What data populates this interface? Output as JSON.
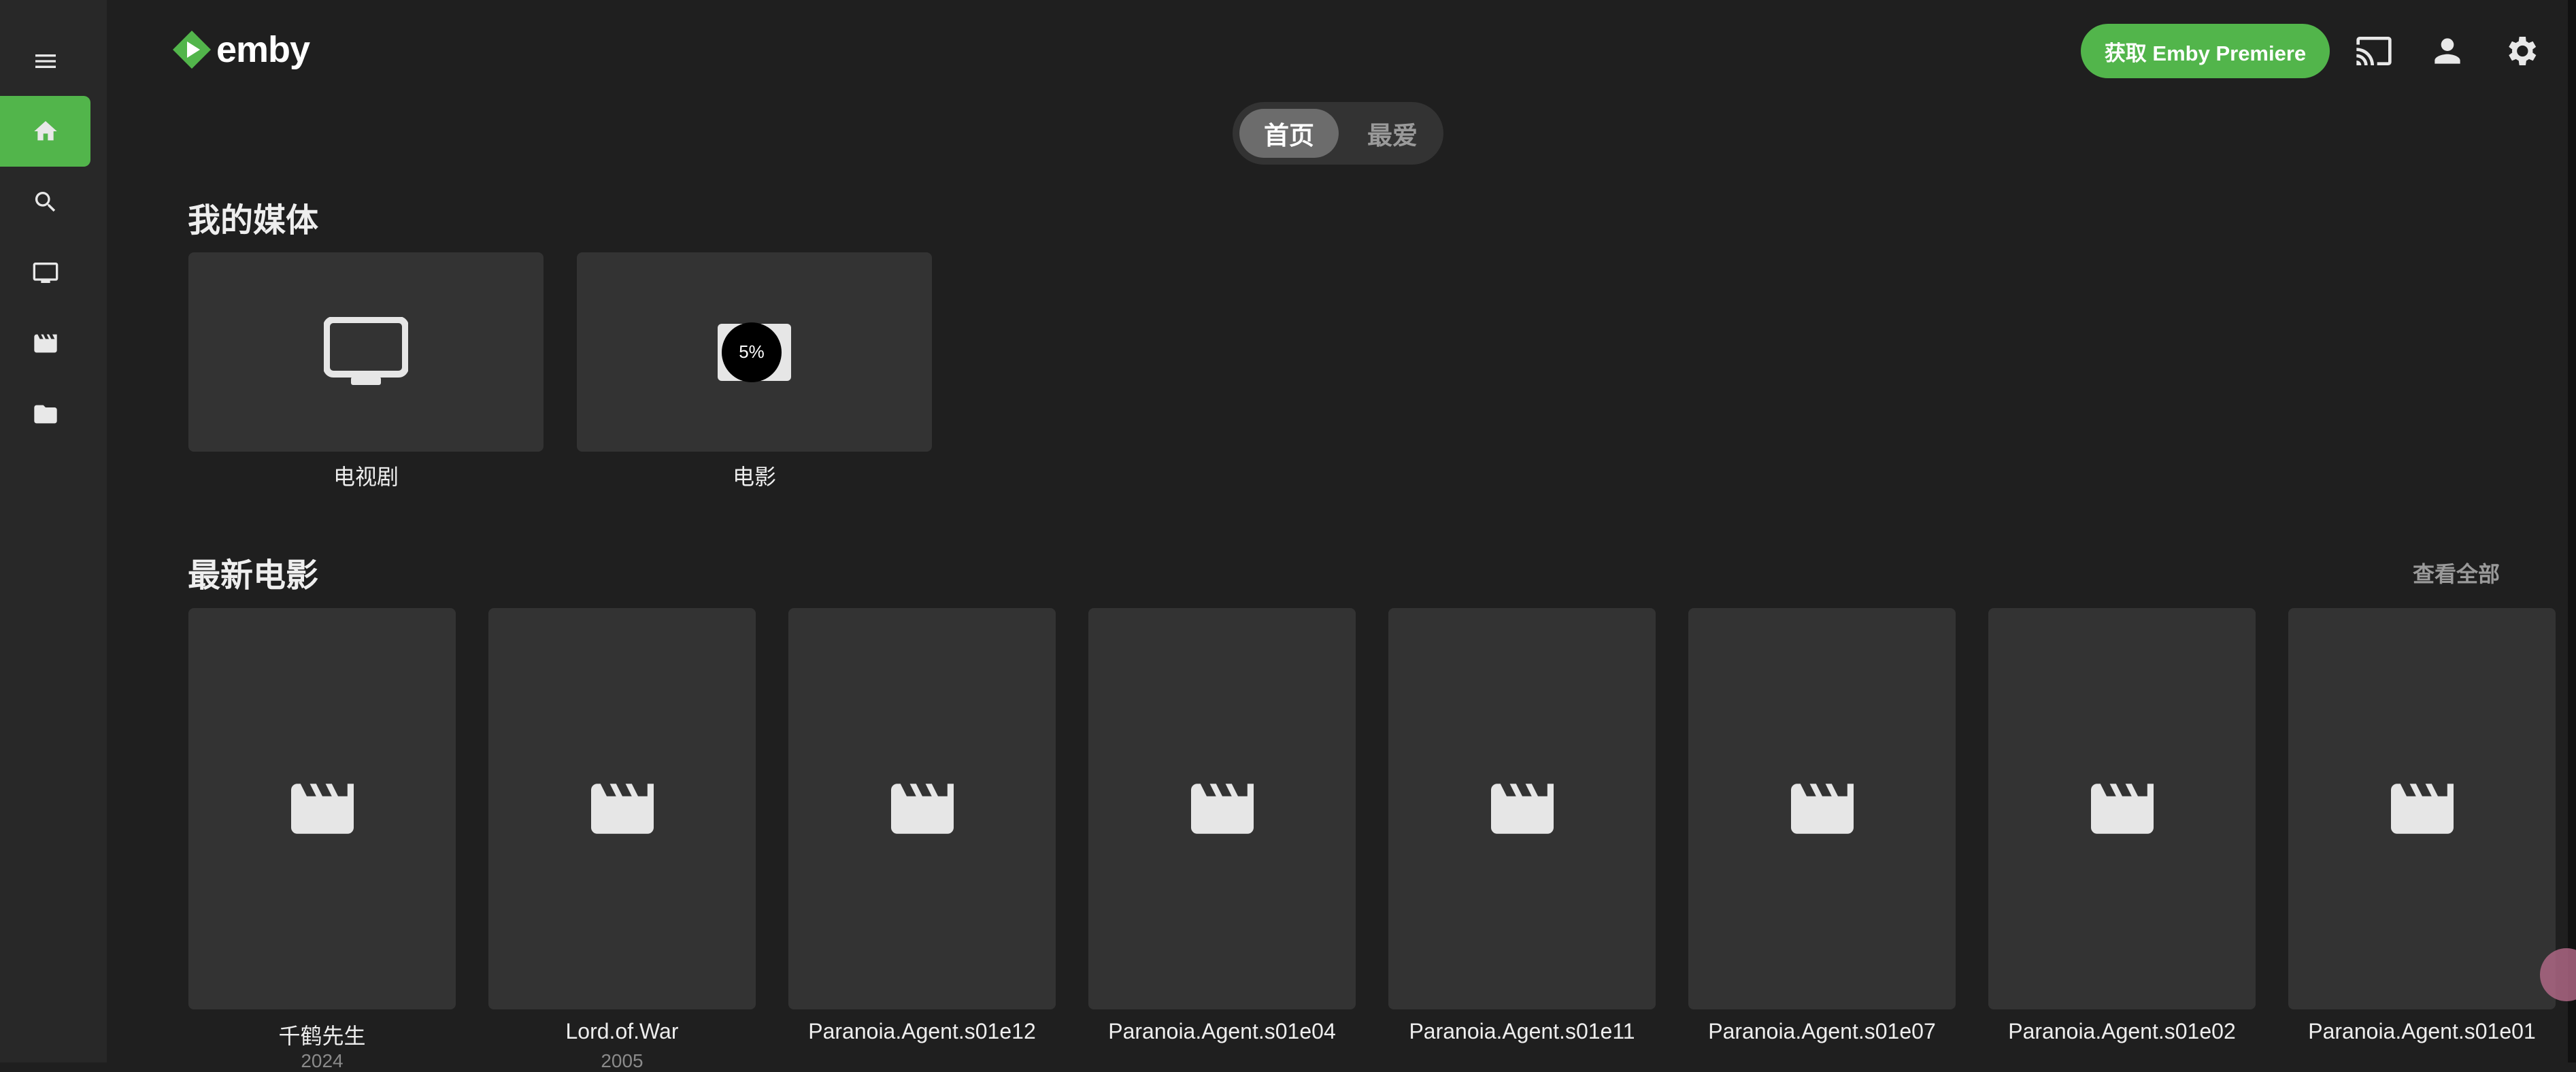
{
  "app": {
    "brand": "emby",
    "accent_color": "#52b54b"
  },
  "sidebar": {
    "items": [
      {
        "name": "menu",
        "icon": "hamburger-icon"
      },
      {
        "name": "home",
        "icon": "home-icon",
        "active": true
      },
      {
        "name": "search",
        "icon": "search-icon"
      },
      {
        "name": "tv",
        "icon": "tv-icon"
      },
      {
        "name": "movies",
        "icon": "movie-icon"
      },
      {
        "name": "folders",
        "icon": "folder-icon"
      }
    ]
  },
  "header": {
    "premiere_label": "获取 Emby Premiere",
    "icons": [
      "cast-icon",
      "user-icon",
      "settings-icon"
    ]
  },
  "tabs": [
    {
      "label": "首页",
      "active": true
    },
    {
      "label": "最爱",
      "active": false
    }
  ],
  "my_media": {
    "title": "我的媒体",
    "libraries": [
      {
        "label": "电视剧",
        "icon": "tv-icon"
      },
      {
        "label": "电影",
        "icon": "movie-icon",
        "progress_label": "5%",
        "progress": 0.05
      }
    ]
  },
  "latest_movies": {
    "title": "最新电影",
    "view_all_label": "查看全部",
    "items": [
      {
        "title": "千鹤先生",
        "year": "2024"
      },
      {
        "title": "Lord.of.War",
        "year": "2005"
      },
      {
        "title": "Paranoia.Agent.s01e12",
        "year": ""
      },
      {
        "title": "Paranoia.Agent.s01e04",
        "year": ""
      },
      {
        "title": "Paranoia.Agent.s01e11",
        "year": ""
      },
      {
        "title": "Paranoia.Agent.s01e07",
        "year": ""
      },
      {
        "title": "Paranoia.Agent.s01e02",
        "year": ""
      },
      {
        "title": "Paranoia.Agent.s01e01",
        "year": ""
      }
    ]
  }
}
